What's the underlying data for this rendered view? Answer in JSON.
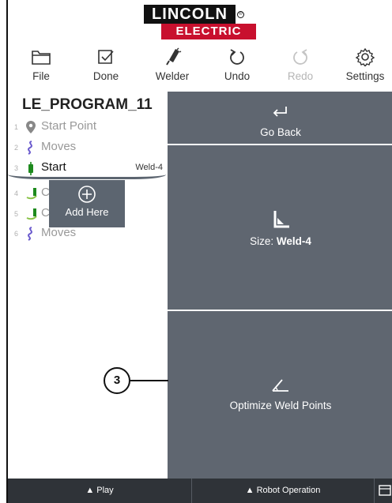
{
  "brand": {
    "line1": "LINCOLN",
    "line2": "ELECTRIC",
    "registered": "®"
  },
  "toolbar": {
    "file": "File",
    "done": "Done",
    "welder": "Welder",
    "undo": "Undo",
    "redo": "Redo",
    "settings": "Settings"
  },
  "program": {
    "name": "LE_PROGRAM_11",
    "items": [
      {
        "num": "1",
        "label": "Start Point",
        "icon": "location-pin-icon"
      },
      {
        "num": "2",
        "label": "Moves",
        "icon": "path-squiggle-icon"
      },
      {
        "num": "3",
        "label": "Start",
        "tag": "Weld-4",
        "icon": "torch-start-icon"
      },
      {
        "num": "4",
        "label": "C",
        "icon": "weld-seam-icon"
      },
      {
        "num": "5",
        "label": "C",
        "icon": "weld-seam-icon"
      },
      {
        "num": "6",
        "label": "Moves",
        "icon": "path-squiggle-icon"
      }
    ],
    "add_here": "Add Here"
  },
  "panel": {
    "go_back": "Go Back",
    "size_prefix": "Size: ",
    "size_value": "Weld-4",
    "optimize": "Optimize Weld Points"
  },
  "callout": "3",
  "bottom": {
    "play": "▲ Play",
    "robot_operation": "▲ Robot Operation"
  },
  "colors": {
    "panel": "#5f6670",
    "brand_red": "#c8102e",
    "active_green": "#1e8a1e",
    "path_purple": "#6a5acd",
    "bottom_bar": "#2f3338"
  }
}
